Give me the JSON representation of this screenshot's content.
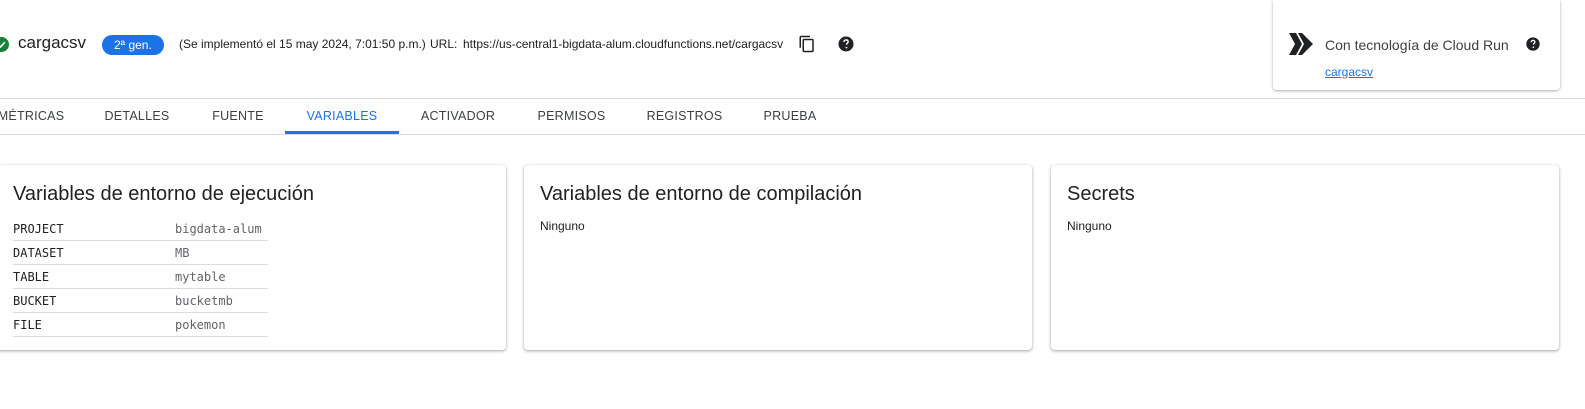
{
  "header": {
    "function_name": "cargacsv",
    "generation_badge": "2ª gen.",
    "deploy_info": "(Se implementó el 15 may 2024, 7:01:50 p.m.)",
    "url_label": "URL:",
    "url_value": "https://us-central1-bigdata-alum.cloudfunctions.net/cargacsv",
    "status_icon": "check-circle-icon",
    "copy_icon": "content-copy-icon",
    "help_icon": "help-circle-icon"
  },
  "cloud_run": {
    "title": "Con tecnología de Cloud Run",
    "link": "cargacsv"
  },
  "tabs": [
    {
      "label": "MÉTRICAS",
      "active": false
    },
    {
      "label": "DETALLES",
      "active": false
    },
    {
      "label": "FUENTE",
      "active": false
    },
    {
      "label": "VARIABLES",
      "active": true
    },
    {
      "label": "ACTIVADOR",
      "active": false
    },
    {
      "label": "PERMISOS",
      "active": false
    },
    {
      "label": "REGISTROS",
      "active": false
    },
    {
      "label": "PRUEBA",
      "active": false
    }
  ],
  "runtime_vars": {
    "title": "Variables de entorno de ejecución",
    "rows": [
      {
        "key": "PROJECT",
        "value": "bigdata-alum"
      },
      {
        "key": "DATASET",
        "value": "MB"
      },
      {
        "key": "TABLE",
        "value": "mytable"
      },
      {
        "key": "BUCKET",
        "value": "bucketmb"
      },
      {
        "key": "FILE",
        "value": "pokemon"
      }
    ]
  },
  "build_vars": {
    "title": "Variables de entorno de compilación",
    "empty_text": "Ninguno"
  },
  "secrets": {
    "title": "Secrets",
    "empty_text": "Ninguno"
  },
  "colors": {
    "accent": "#1a73e8",
    "success": "#188038",
    "divider": "#dadce0"
  }
}
